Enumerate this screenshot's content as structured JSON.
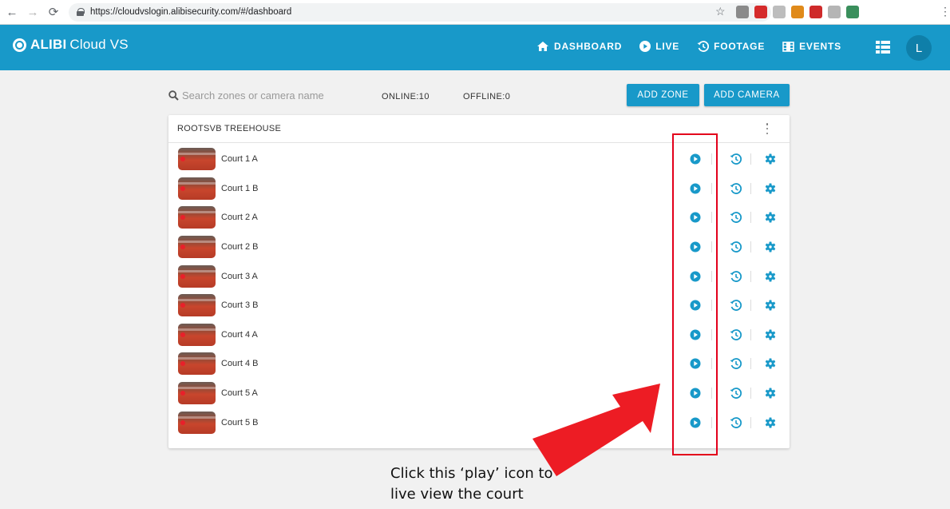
{
  "browser": {
    "url": "https://cloudvslogin.alibisecurity.com/#/dashboard",
    "extension_colors": [
      "#8a8a8a",
      "#d52b2b",
      "#bdbdbd",
      "#e08a1a",
      "#cf2a2a",
      "#b5b5b5",
      "#3a8f5c"
    ]
  },
  "header": {
    "brand": "ALIBI",
    "product": "Cloud VS",
    "nav": [
      {
        "label": "DASHBOARD",
        "icon": "home-icon"
      },
      {
        "label": "LIVE",
        "icon": "play-circle-icon"
      },
      {
        "label": "FOOTAGE",
        "icon": "history-icon"
      },
      {
        "label": "EVENTS",
        "icon": "film-icon"
      }
    ],
    "avatar_initial": "L"
  },
  "toolbar": {
    "search_placeholder": "Search zones or camera name",
    "online_label": "ONLINE:10",
    "offline_label": "OFFLINE:0",
    "add_zone": "ADD ZONE",
    "add_camera": "ADD CAMERA"
  },
  "zone": {
    "title": "ROOTSVB TREEHOUSE",
    "cameras": [
      {
        "name": "Court 1 A"
      },
      {
        "name": "Court 1 B"
      },
      {
        "name": "Court 2 A"
      },
      {
        "name": "Court 2 B"
      },
      {
        "name": "Court 3 A"
      },
      {
        "name": "Court 3 B"
      },
      {
        "name": "Court 4 A"
      },
      {
        "name": "Court 4 B"
      },
      {
        "name": "Court 5 A"
      },
      {
        "name": "Court 5 B"
      }
    ]
  },
  "annotation": {
    "caption_line1": "Click this ‘play’ icon to",
    "caption_line2": "live view the court"
  },
  "colors": {
    "accent": "#1899c9",
    "background": "#f1f1f1",
    "annotation_red": "#e3001b"
  }
}
